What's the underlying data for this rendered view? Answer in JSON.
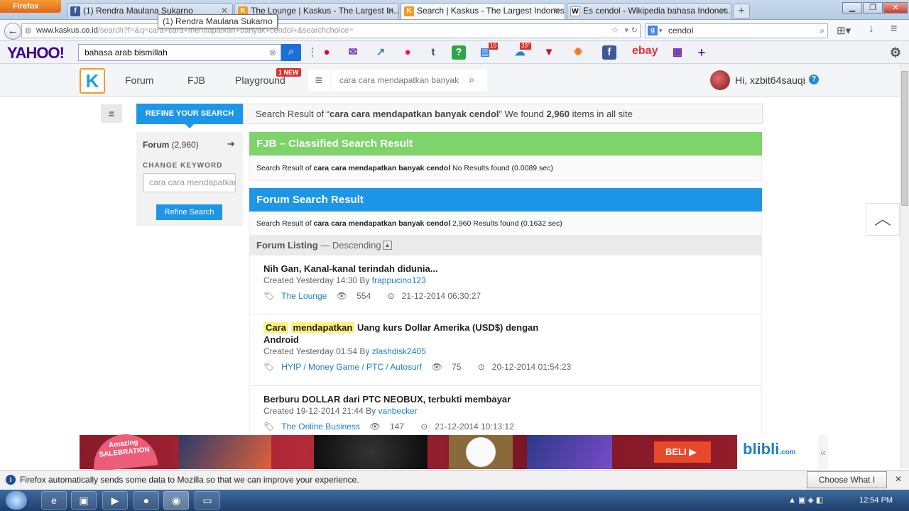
{
  "browser": {
    "firefox_label": "Firefox",
    "tabs": [
      {
        "title": "(1) Rendra Maulana Sukarno",
        "favicon": "facebook-icon"
      },
      {
        "title": "The Lounge | Kaskus - The Largest In...",
        "favicon": "kaskus-icon"
      },
      {
        "title": "Search | Kaskus - The Largest Indones...",
        "favicon": "kaskus-icon",
        "active": true
      },
      {
        "title": "Es cendol - Wikipedia bahasa Indones...",
        "favicon": "wikipedia-icon"
      }
    ],
    "tooltip": "(1) Rendra Maulana Sukarno",
    "url_host": "www.kaskus.co.id",
    "url_path": "/search?f=&q=cara+cara+mendapatkan+banyak+cendol+&searchchoice=",
    "search_value": "cendol"
  },
  "yahoo": {
    "logo": "YAHOO!",
    "search_value": "bahasa arab bismillah",
    "badges": {
      "news": "10",
      "weather": "33°"
    },
    "ebay": "ebay"
  },
  "kaskus": {
    "nav": {
      "forum": "Forum",
      "fjb": "FJB",
      "playground": "Playground",
      "new_badge": "1 NEW"
    },
    "search_value": "cara cara mendapatkan banyak",
    "greeting": "Hi, xzbit64sauqi",
    "refine_tab": "REFINE YOUR SEARCH",
    "summary": {
      "prefix": "Search Result of “",
      "query": "cara cara mendapatkan banyak cendol",
      "mid": "” We found ",
      "count": "2,960",
      "suffix": " items in all site"
    },
    "sidebar": {
      "forum_label": "Forum",
      "forum_count": "(2,960)",
      "change_keyword": "CHANGE KEYWORD",
      "keyword_value": "cara cara mendapatkan",
      "refine_button": "Refine Search"
    },
    "fjb": {
      "heading": "FJB – Classified Search Result",
      "info_prefix": "Search Result of ",
      "info_query": "cara cara mendapatkan banyak cendol",
      "info_suffix": "  No Results found (0.0089 sec)"
    },
    "forum": {
      "heading": "Forum Search Result",
      "info_prefix": "Search Result of ",
      "info_query": "cara cara mendapatkan banyak cendol",
      "info_suffix": " 2,960 Results found (0.1632 sec)"
    },
    "listing": {
      "label": "Forum Listing",
      "order": " — Descending"
    },
    "posts": [
      {
        "title": "Nih Gan, Kanal-kanal terindah didunia...",
        "created": "Created Yesterday 14:30 By ",
        "author": "frappucino123",
        "category": "The Lounge",
        "views": "554",
        "date": "21-12-2014 06:30:27"
      },
      {
        "title_hl1": "Cara",
        "title_hl2": "mendapatkan",
        "title_rest": " Uang kurs Dollar Amerika (USD$) dengan Android",
        "created": "Created Yesterday 01:54 By ",
        "author": "zlashdisk2405",
        "category": "HYIP / Money Game / PTC / Autosurf",
        "views": "75",
        "date": "20-12-2014 01:54:23"
      },
      {
        "title": "Berburu DOLLAR dari PTC NEOBUX, terbukti membayar",
        "created": "Created 19-12-2014 21:44 By ",
        "author": "vanbecker",
        "category": "The Online Business",
        "views": "147",
        "date": "21-12-2014 10:13:12"
      }
    ],
    "banner": {
      "sale_line1": "Amazing",
      "sale_line2": "SALEBRATION",
      "beli": "BELI",
      "brand": "blibli",
      "brand_suffix": ".com"
    }
  },
  "notification": {
    "text": "Firefox automatically sends some data to Mozilla so that we can improve your experience.",
    "button": "Choose What I Share"
  },
  "taskbar": {
    "time": "12:54 PM"
  }
}
